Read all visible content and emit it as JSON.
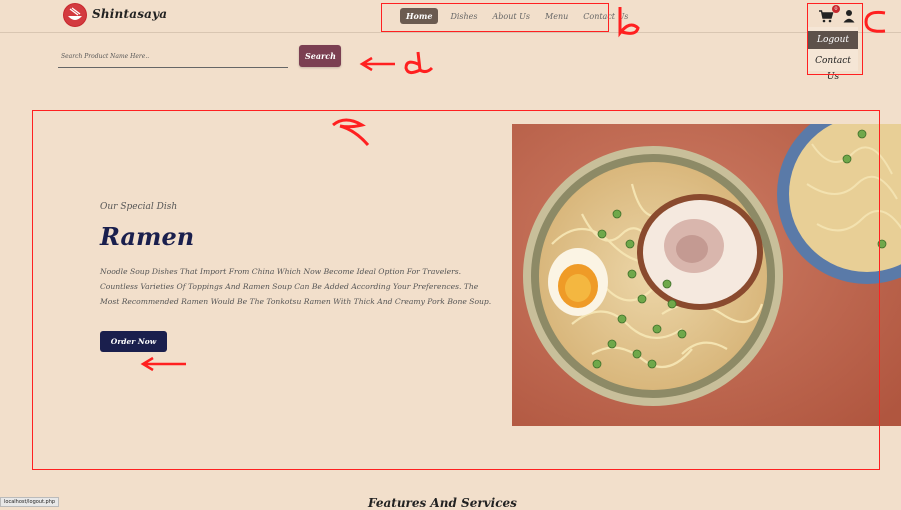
{
  "brand": {
    "name": "Shintasaya"
  },
  "nav": {
    "items": [
      {
        "label": "Home",
        "active": true
      },
      {
        "label": "Dishes",
        "active": false
      },
      {
        "label": "About Us",
        "active": false
      },
      {
        "label": "Menu",
        "active": false
      },
      {
        "label": "Contact Us",
        "active": false
      }
    ]
  },
  "cart": {
    "badge": "0",
    "icon": "cart-icon"
  },
  "user_menu": {
    "icon": "user-icon",
    "items": [
      {
        "label": "Logout"
      },
      {
        "label": "Contact Us"
      }
    ]
  },
  "search": {
    "placeholder": "Search Product Name Here..",
    "button_label": "Search"
  },
  "hero": {
    "subtitle": "Our Special Dish",
    "title": "Ramen",
    "description": "Noodle Soup Dishes That Import From China Which Now Become Ideal Option For Travelers. Countless Varieties Of Toppings And Ramen Soup Can Be Added According Your Preferences. The Most Recommended Ramen Would Be The Tonkotsu Ramen With Thick And Creamy Pork Bone Soup.",
    "button_label": "Order Now",
    "image": "ramen-bowl-photo"
  },
  "annotations": {
    "labels": {
      "a": "a",
      "b": "b",
      "c": "c",
      "d": "d"
    },
    "color": "#ff2020"
  },
  "status_bar": {
    "url": "localhost/logout.php"
  },
  "next_section": {
    "heading": "Features And Services"
  },
  "colors": {
    "background": "#f2dfcb",
    "nav_active": "#6b5b50",
    "search_button": "#7b3f52",
    "primary_dark": "#1a1f4d",
    "badge": "#c7282e"
  }
}
